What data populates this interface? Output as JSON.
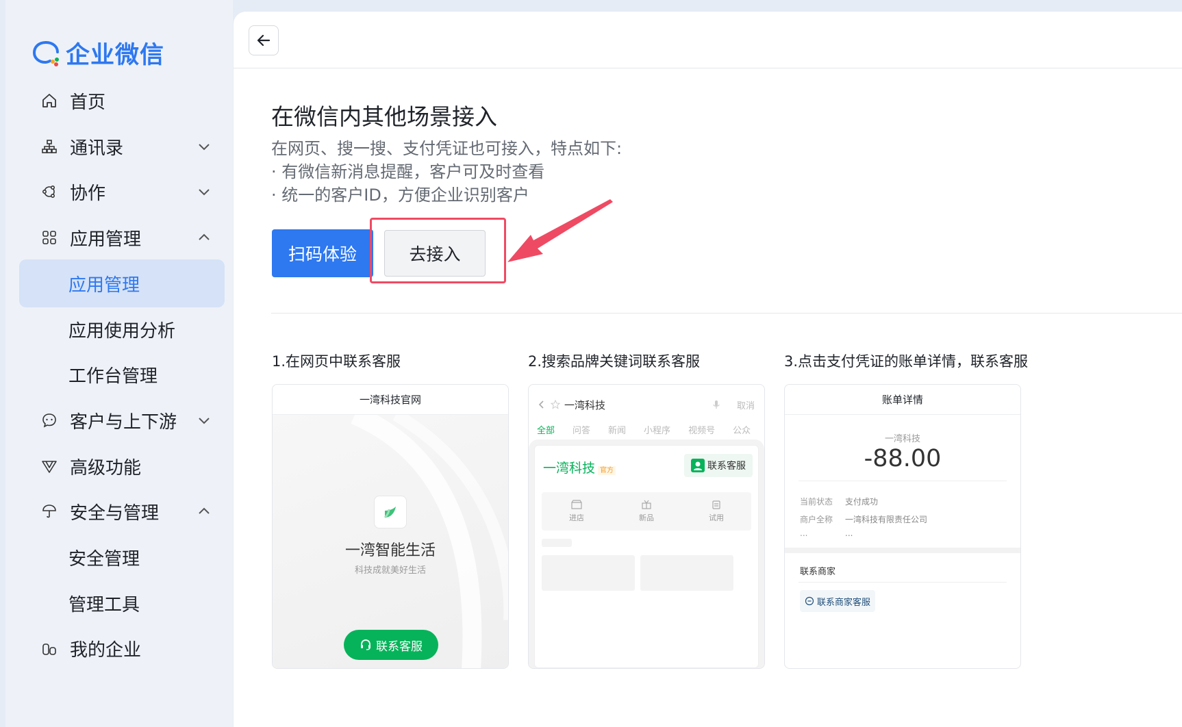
{
  "sidebar": {
    "logo_text": "企业微信",
    "items": [
      {
        "label": "首页"
      },
      {
        "label": "通讯录"
      },
      {
        "label": "协作"
      },
      {
        "label": "应用管理"
      },
      {
        "label": "应用管理"
      },
      {
        "label": "应用使用分析"
      },
      {
        "label": "工作台管理"
      },
      {
        "label": "客户与上下游"
      },
      {
        "label": "高级功能"
      },
      {
        "label": "安全与管理"
      },
      {
        "label": "安全管理"
      },
      {
        "label": "管理工具"
      },
      {
        "label": "我的企业"
      }
    ]
  },
  "main": {
    "title": "在微信内其他场景接入",
    "desc": [
      "在网页、搜一搜、支付凭证也可接入，特点如下:",
      "· 有微信新消息提醒，客户可及时查看",
      "· 统一的客户ID，方便企业识别客户"
    ],
    "btn_scan": "扫码体验",
    "btn_go": "去接入"
  },
  "steps": [
    {
      "label": "1.在网页中联系客服"
    },
    {
      "label": "2.搜索品牌关键词联系客服"
    },
    {
      "label": "3.点击支付凭证的账单详情，联系客服"
    }
  ],
  "card1": {
    "header": "一湾科技官网",
    "name": "一湾智能生活",
    "slogan": "科技成就美好生活",
    "button": "联系客服"
  },
  "card2": {
    "query": "一湾科技",
    "cancel": "取消",
    "tabs": [
      "全部",
      "问答",
      "新闻",
      "小程序",
      "视频号",
      "公众"
    ],
    "brand": "一湾科技",
    "official": "官方",
    "cs_button": "联系客服",
    "grid": [
      "进店",
      "新品",
      "试用"
    ]
  },
  "card3": {
    "header": "账单详情",
    "merchant": "一湾科技",
    "amount": "-88.00",
    "rows": [
      {
        "k": "当前状态",
        "v": "支付成功"
      },
      {
        "k": "商户全称",
        "v": "一湾科技有限责任公司"
      },
      {
        "k": "...",
        "v": "..."
      }
    ],
    "contact_label": "联系商家",
    "contact_button": "联系商家客服"
  },
  "colors": {
    "accent": "#2e78f0",
    "wechat_green": "#07b35a",
    "highlight_red": "#ef4a63"
  }
}
